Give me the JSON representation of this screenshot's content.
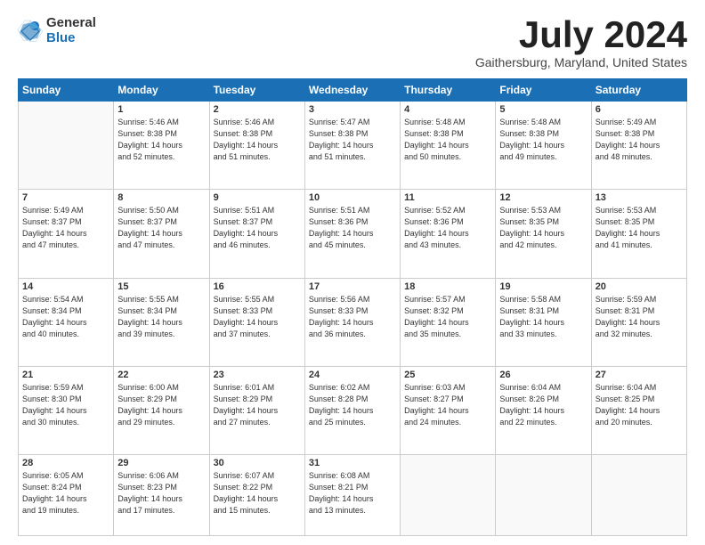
{
  "logo": {
    "general": "General",
    "blue": "Blue"
  },
  "title": {
    "month": "July 2024",
    "location": "Gaithersburg, Maryland, United States"
  },
  "days": [
    "Sunday",
    "Monday",
    "Tuesday",
    "Wednesday",
    "Thursday",
    "Friday",
    "Saturday"
  ],
  "weeks": [
    [
      {
        "day": "",
        "info": ""
      },
      {
        "day": "1",
        "info": "Sunrise: 5:46 AM\nSunset: 8:38 PM\nDaylight: 14 hours\nand 52 minutes."
      },
      {
        "day": "2",
        "info": "Sunrise: 5:46 AM\nSunset: 8:38 PM\nDaylight: 14 hours\nand 51 minutes."
      },
      {
        "day": "3",
        "info": "Sunrise: 5:47 AM\nSunset: 8:38 PM\nDaylight: 14 hours\nand 51 minutes."
      },
      {
        "day": "4",
        "info": "Sunrise: 5:48 AM\nSunset: 8:38 PM\nDaylight: 14 hours\nand 50 minutes."
      },
      {
        "day": "5",
        "info": "Sunrise: 5:48 AM\nSunset: 8:38 PM\nDaylight: 14 hours\nand 49 minutes."
      },
      {
        "day": "6",
        "info": "Sunrise: 5:49 AM\nSunset: 8:38 PM\nDaylight: 14 hours\nand 48 minutes."
      }
    ],
    [
      {
        "day": "7",
        "info": "Sunrise: 5:49 AM\nSunset: 8:37 PM\nDaylight: 14 hours\nand 47 minutes."
      },
      {
        "day": "8",
        "info": "Sunrise: 5:50 AM\nSunset: 8:37 PM\nDaylight: 14 hours\nand 47 minutes."
      },
      {
        "day": "9",
        "info": "Sunrise: 5:51 AM\nSunset: 8:37 PM\nDaylight: 14 hours\nand 46 minutes."
      },
      {
        "day": "10",
        "info": "Sunrise: 5:51 AM\nSunset: 8:36 PM\nDaylight: 14 hours\nand 45 minutes."
      },
      {
        "day": "11",
        "info": "Sunrise: 5:52 AM\nSunset: 8:36 PM\nDaylight: 14 hours\nand 43 minutes."
      },
      {
        "day": "12",
        "info": "Sunrise: 5:53 AM\nSunset: 8:35 PM\nDaylight: 14 hours\nand 42 minutes."
      },
      {
        "day": "13",
        "info": "Sunrise: 5:53 AM\nSunset: 8:35 PM\nDaylight: 14 hours\nand 41 minutes."
      }
    ],
    [
      {
        "day": "14",
        "info": "Sunrise: 5:54 AM\nSunset: 8:34 PM\nDaylight: 14 hours\nand 40 minutes."
      },
      {
        "day": "15",
        "info": "Sunrise: 5:55 AM\nSunset: 8:34 PM\nDaylight: 14 hours\nand 39 minutes."
      },
      {
        "day": "16",
        "info": "Sunrise: 5:55 AM\nSunset: 8:33 PM\nDaylight: 14 hours\nand 37 minutes."
      },
      {
        "day": "17",
        "info": "Sunrise: 5:56 AM\nSunset: 8:33 PM\nDaylight: 14 hours\nand 36 minutes."
      },
      {
        "day": "18",
        "info": "Sunrise: 5:57 AM\nSunset: 8:32 PM\nDaylight: 14 hours\nand 35 minutes."
      },
      {
        "day": "19",
        "info": "Sunrise: 5:58 AM\nSunset: 8:31 PM\nDaylight: 14 hours\nand 33 minutes."
      },
      {
        "day": "20",
        "info": "Sunrise: 5:59 AM\nSunset: 8:31 PM\nDaylight: 14 hours\nand 32 minutes."
      }
    ],
    [
      {
        "day": "21",
        "info": "Sunrise: 5:59 AM\nSunset: 8:30 PM\nDaylight: 14 hours\nand 30 minutes."
      },
      {
        "day": "22",
        "info": "Sunrise: 6:00 AM\nSunset: 8:29 PM\nDaylight: 14 hours\nand 29 minutes."
      },
      {
        "day": "23",
        "info": "Sunrise: 6:01 AM\nSunset: 8:29 PM\nDaylight: 14 hours\nand 27 minutes."
      },
      {
        "day": "24",
        "info": "Sunrise: 6:02 AM\nSunset: 8:28 PM\nDaylight: 14 hours\nand 25 minutes."
      },
      {
        "day": "25",
        "info": "Sunrise: 6:03 AM\nSunset: 8:27 PM\nDaylight: 14 hours\nand 24 minutes."
      },
      {
        "day": "26",
        "info": "Sunrise: 6:04 AM\nSunset: 8:26 PM\nDaylight: 14 hours\nand 22 minutes."
      },
      {
        "day": "27",
        "info": "Sunrise: 6:04 AM\nSunset: 8:25 PM\nDaylight: 14 hours\nand 20 minutes."
      }
    ],
    [
      {
        "day": "28",
        "info": "Sunrise: 6:05 AM\nSunset: 8:24 PM\nDaylight: 14 hours\nand 19 minutes."
      },
      {
        "day": "29",
        "info": "Sunrise: 6:06 AM\nSunset: 8:23 PM\nDaylight: 14 hours\nand 17 minutes."
      },
      {
        "day": "30",
        "info": "Sunrise: 6:07 AM\nSunset: 8:22 PM\nDaylight: 14 hours\nand 15 minutes."
      },
      {
        "day": "31",
        "info": "Sunrise: 6:08 AM\nSunset: 8:21 PM\nDaylight: 14 hours\nand 13 minutes."
      },
      {
        "day": "",
        "info": ""
      },
      {
        "day": "",
        "info": ""
      },
      {
        "day": "",
        "info": ""
      }
    ]
  ]
}
